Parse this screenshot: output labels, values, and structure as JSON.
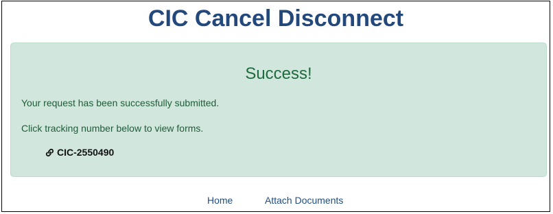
{
  "header": {
    "title": "CIC Cancel Disconnect"
  },
  "alert": {
    "heading": "Success!",
    "message": "Your request has been successfully submitted.",
    "instruction": "Click tracking number below to view forms.",
    "tracking_number": "CIC-2550490",
    "tracking_icon": "link-icon",
    "background_color": "#d1e7dd",
    "text_color": "#0f5132"
  },
  "nav": {
    "home_label": "Home",
    "attach_label": "Attach Documents",
    "link_color": "#1f4e80"
  },
  "colors": {
    "title": "#23487b"
  }
}
